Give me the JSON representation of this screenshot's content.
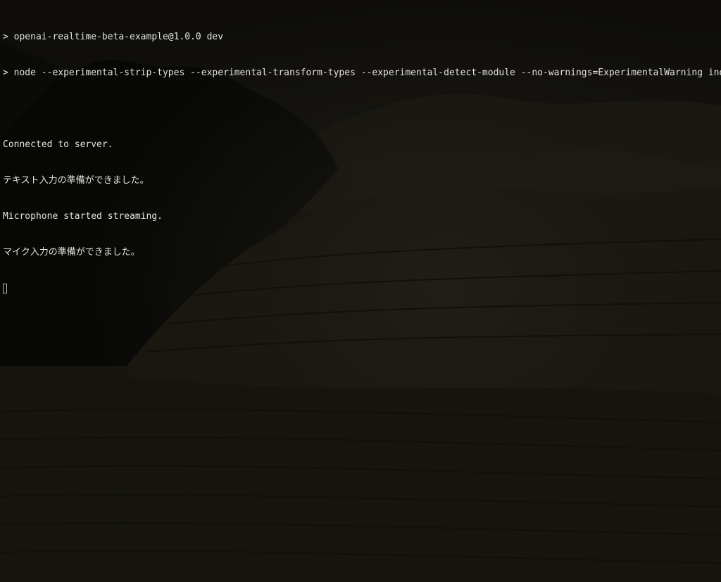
{
  "terminal": {
    "script_header": "> openai-realtime-beta-example@1.0.0 dev",
    "command": "> node --experimental-strip-types --experimental-transform-types --experimental-detect-module --no-warnings=ExperimentalWarning index.ts",
    "output_lines": [
      "Connected to server.",
      "テキスト入力の準備ができました。",
      "Microphone started streaming.",
      "マイク入力の準備ができました。"
    ]
  },
  "colors": {
    "background": "#0b0a08",
    "text": "#e4e2dc",
    "cursor": "#bdbab2"
  },
  "icons": {
    "cursor": "block-cursor-outline"
  }
}
